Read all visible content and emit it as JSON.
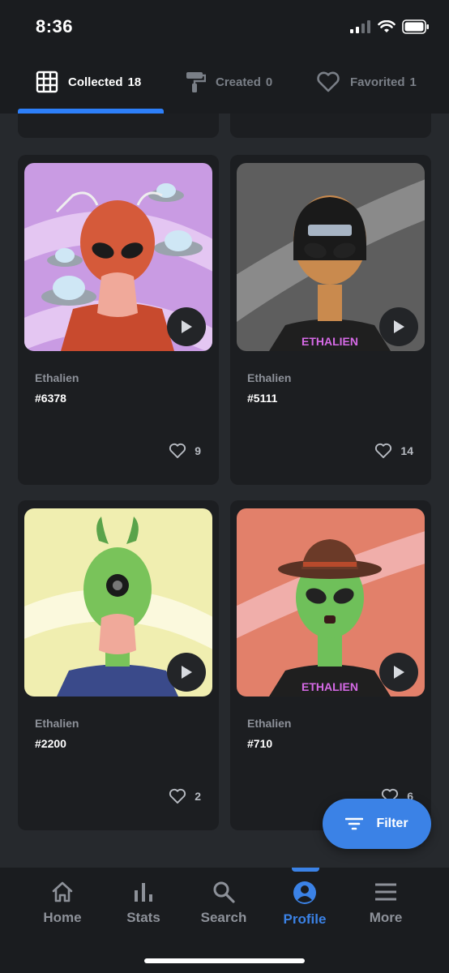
{
  "status_bar": {
    "time": "8:36"
  },
  "tabs": [
    {
      "label": "Collected",
      "count": "18",
      "icon": "grid-icon"
    },
    {
      "label": "Created",
      "count": "0",
      "icon": "paint-roller-icon"
    },
    {
      "label": "Favorited",
      "count": "1",
      "icon": "heart-icon"
    }
  ],
  "cards": [
    {
      "collection": "Ethalien",
      "token": "#6378",
      "likes": "9"
    },
    {
      "collection": "Ethalien",
      "token": "#5111",
      "likes": "14"
    },
    {
      "collection": "Ethalien",
      "token": "#2200",
      "likes": "2"
    },
    {
      "collection": "Ethalien",
      "token": "#710",
      "likes": "6"
    }
  ],
  "filter_button": {
    "label": "Filter"
  },
  "bottom_nav": [
    {
      "label": "Home",
      "icon": "home-icon"
    },
    {
      "label": "Stats",
      "icon": "bar-chart-icon"
    },
    {
      "label": "Search",
      "icon": "search-icon"
    },
    {
      "label": "Profile",
      "icon": "profile-icon",
      "active": true
    },
    {
      "label": "More",
      "icon": "menu-icon"
    }
  ],
  "colors": {
    "accent": "#3b82e6",
    "background": "#26292d",
    "card": "#1c1e21"
  }
}
